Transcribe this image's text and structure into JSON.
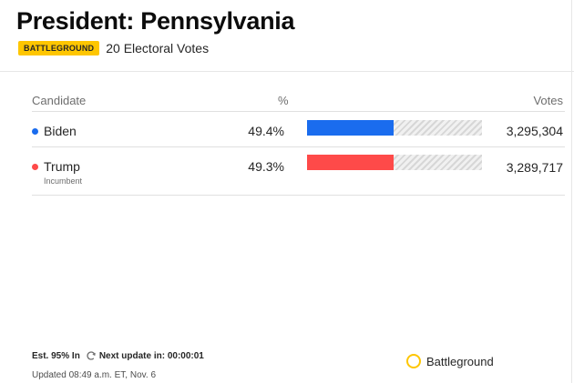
{
  "header": {
    "title": "President: Pennsylvania",
    "badge": "BATTLEGROUND",
    "electoral_votes": "20 Electoral Votes"
  },
  "table": {
    "columns": {
      "candidate": "Candidate",
      "percent": "%",
      "votes": "Votes"
    },
    "rows": [
      {
        "name": "Biden",
        "note": "",
        "percent": "49.4%",
        "votes": "3,295,304",
        "bar_fraction": 0.494,
        "color": "#1a6cee"
      },
      {
        "name": "Trump",
        "note": "Incumbent",
        "percent": "49.3%",
        "votes": "3,289,717",
        "bar_fraction": 0.493,
        "color": "#fe4a49"
      }
    ]
  },
  "footer": {
    "estimate": "Est. 95% In",
    "next_update": "Next update in: 00:00:01",
    "updated": "Updated 08:49 a.m. ET, Nov. 6",
    "refresh_icon": "refresh-icon",
    "legend_label": "Battleground",
    "legend_color": "#fec601"
  }
}
